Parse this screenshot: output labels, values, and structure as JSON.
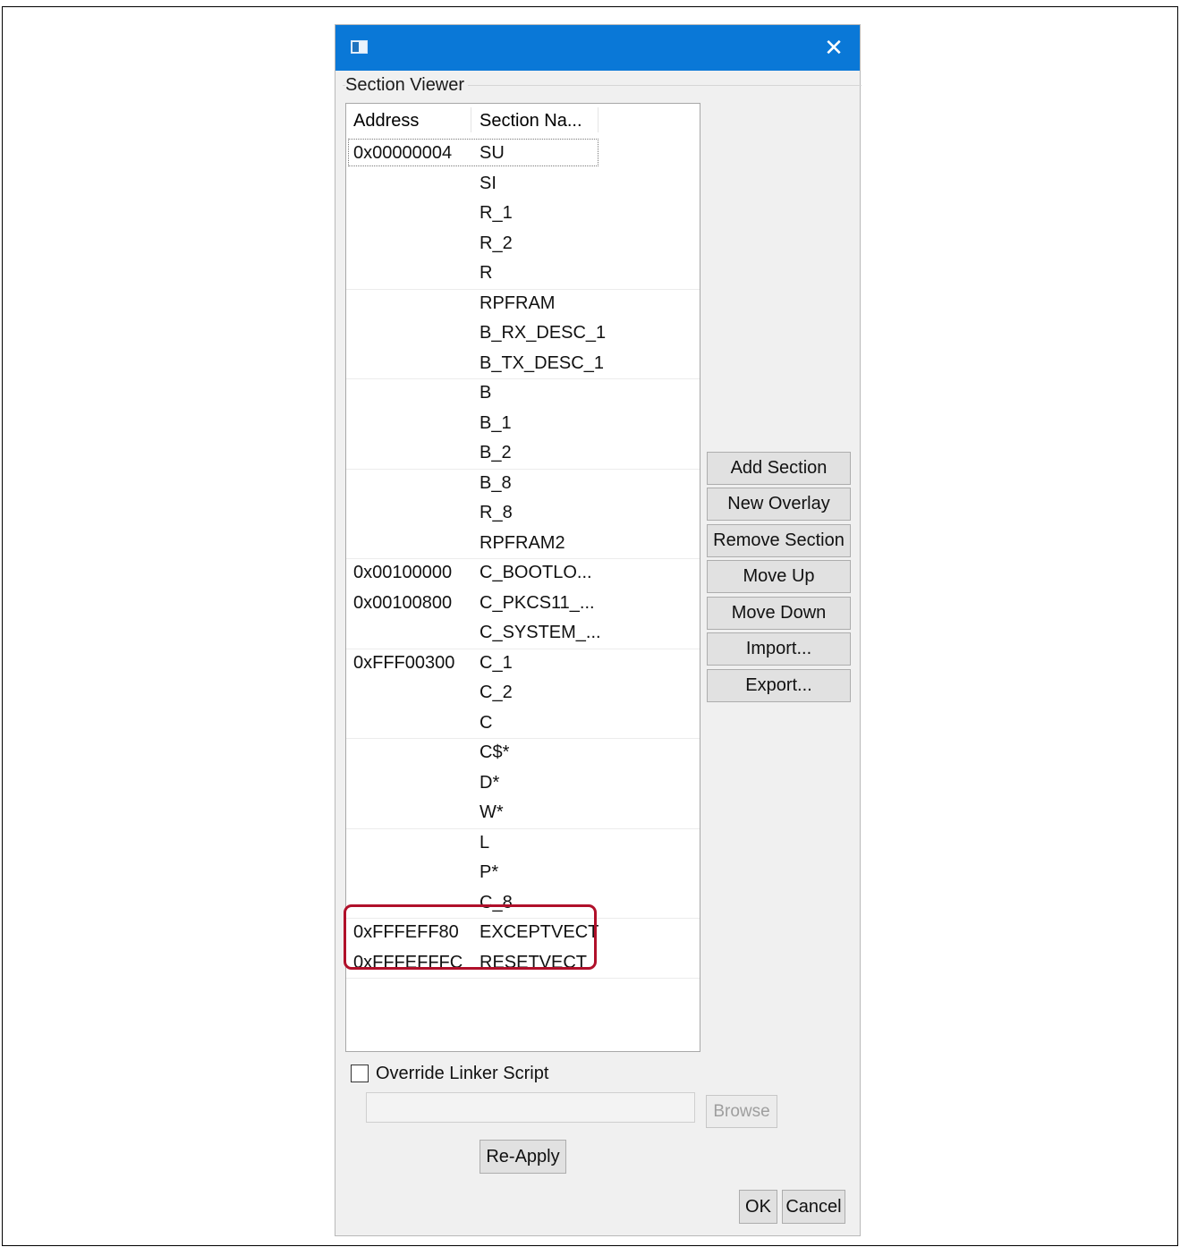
{
  "dialog": {
    "group_title": "Section Viewer",
    "columns": {
      "address": "Address",
      "section_name": "Section Na..."
    },
    "rows": [
      {
        "address": "0x00000004",
        "name": "SU"
      },
      {
        "address": "",
        "name": "SI"
      },
      {
        "address": "",
        "name": "R_1"
      },
      {
        "address": "",
        "name": "R_2"
      },
      {
        "address": "",
        "name": "R"
      },
      {
        "address": "",
        "name": "RPFRAM"
      },
      {
        "address": "",
        "name": "B_RX_DESC_1"
      },
      {
        "address": "",
        "name": "B_TX_DESC_1"
      },
      {
        "address": "",
        "name": "B"
      },
      {
        "address": "",
        "name": "B_1"
      },
      {
        "address": "",
        "name": "B_2"
      },
      {
        "address": "",
        "name": "B_8"
      },
      {
        "address": "",
        "name": "R_8"
      },
      {
        "address": "",
        "name": "RPFRAM2"
      },
      {
        "address": "0x00100000",
        "name": "C_BOOTLO..."
      },
      {
        "address": "0x00100800",
        "name": "C_PKCS11_..."
      },
      {
        "address": "",
        "name": "C_SYSTEM_..."
      },
      {
        "address": "0xFFF00300",
        "name": "C_1"
      },
      {
        "address": "",
        "name": "C_2"
      },
      {
        "address": "",
        "name": "C"
      },
      {
        "address": "",
        "name": "C$*"
      },
      {
        "address": "",
        "name": "D*"
      },
      {
        "address": "",
        "name": "W*"
      },
      {
        "address": "",
        "name": "L"
      },
      {
        "address": "",
        "name": "P*"
      },
      {
        "address": "",
        "name": "C_8"
      },
      {
        "address": "0xFFFEFF80",
        "name": "EXCEPTVECT"
      },
      {
        "address": "0xFFFEFFFC",
        "name": "RESETVECT"
      }
    ],
    "buttons": {
      "add_section": "Add Section",
      "new_overlay": "New Overlay",
      "remove_section": "Remove Section",
      "move_up": "Move Up",
      "move_down": "Move Down",
      "import": "Import...",
      "export": "Export..."
    },
    "override_label": "Override Linker Script",
    "override_checked": false,
    "linker_script_value": "",
    "browse": "Browse",
    "reapply": "Re-Apply",
    "ok": "OK",
    "cancel": "Cancel",
    "titlebar_color": "#0a78d7",
    "highlight_color": "#b0102a"
  }
}
